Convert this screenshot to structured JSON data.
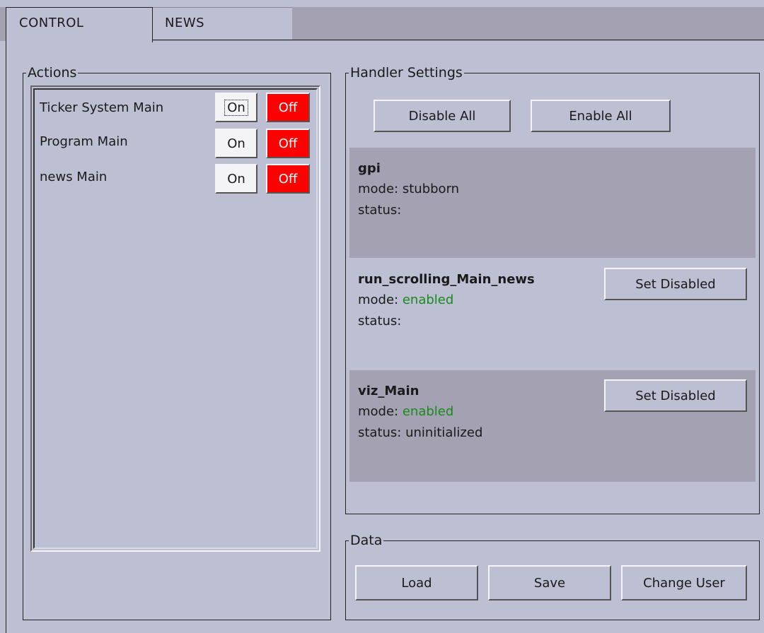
{
  "tabs": [
    {
      "label": "CONTROL"
    },
    {
      "label": "NEWS"
    }
  ],
  "actions": {
    "legend": "Actions",
    "items": [
      {
        "label": "Ticker System Main",
        "on": "On",
        "off": "Off"
      },
      {
        "label": "Program Main",
        "on": "On",
        "off": "Off"
      },
      {
        "label": "news Main",
        "on": "On",
        "off": "Off"
      }
    ]
  },
  "handler_settings": {
    "legend": "Handler Settings",
    "disable_all": "Disable All",
    "enable_all": "Enable All",
    "mode_label": "mode:",
    "status_label": "status:",
    "handlers": [
      {
        "name": "gpi",
        "mode": "stubborn",
        "status": "",
        "button": ""
      },
      {
        "name": "run_scrolling_Main_news",
        "mode": "enabled",
        "status": "",
        "button": "Set Disabled"
      },
      {
        "name": "viz_Main",
        "mode": "enabled",
        "status": "uninitialized",
        "button": "Set Disabled"
      }
    ]
  },
  "data_group": {
    "legend": "Data",
    "load": "Load",
    "save": "Save",
    "change_user": "Change User"
  },
  "colors": {
    "background": "#bcc0d2",
    "off_button": "#ff0000",
    "enabled_text": "#1a8a1a",
    "handler_dark": "#a4a2b2"
  }
}
